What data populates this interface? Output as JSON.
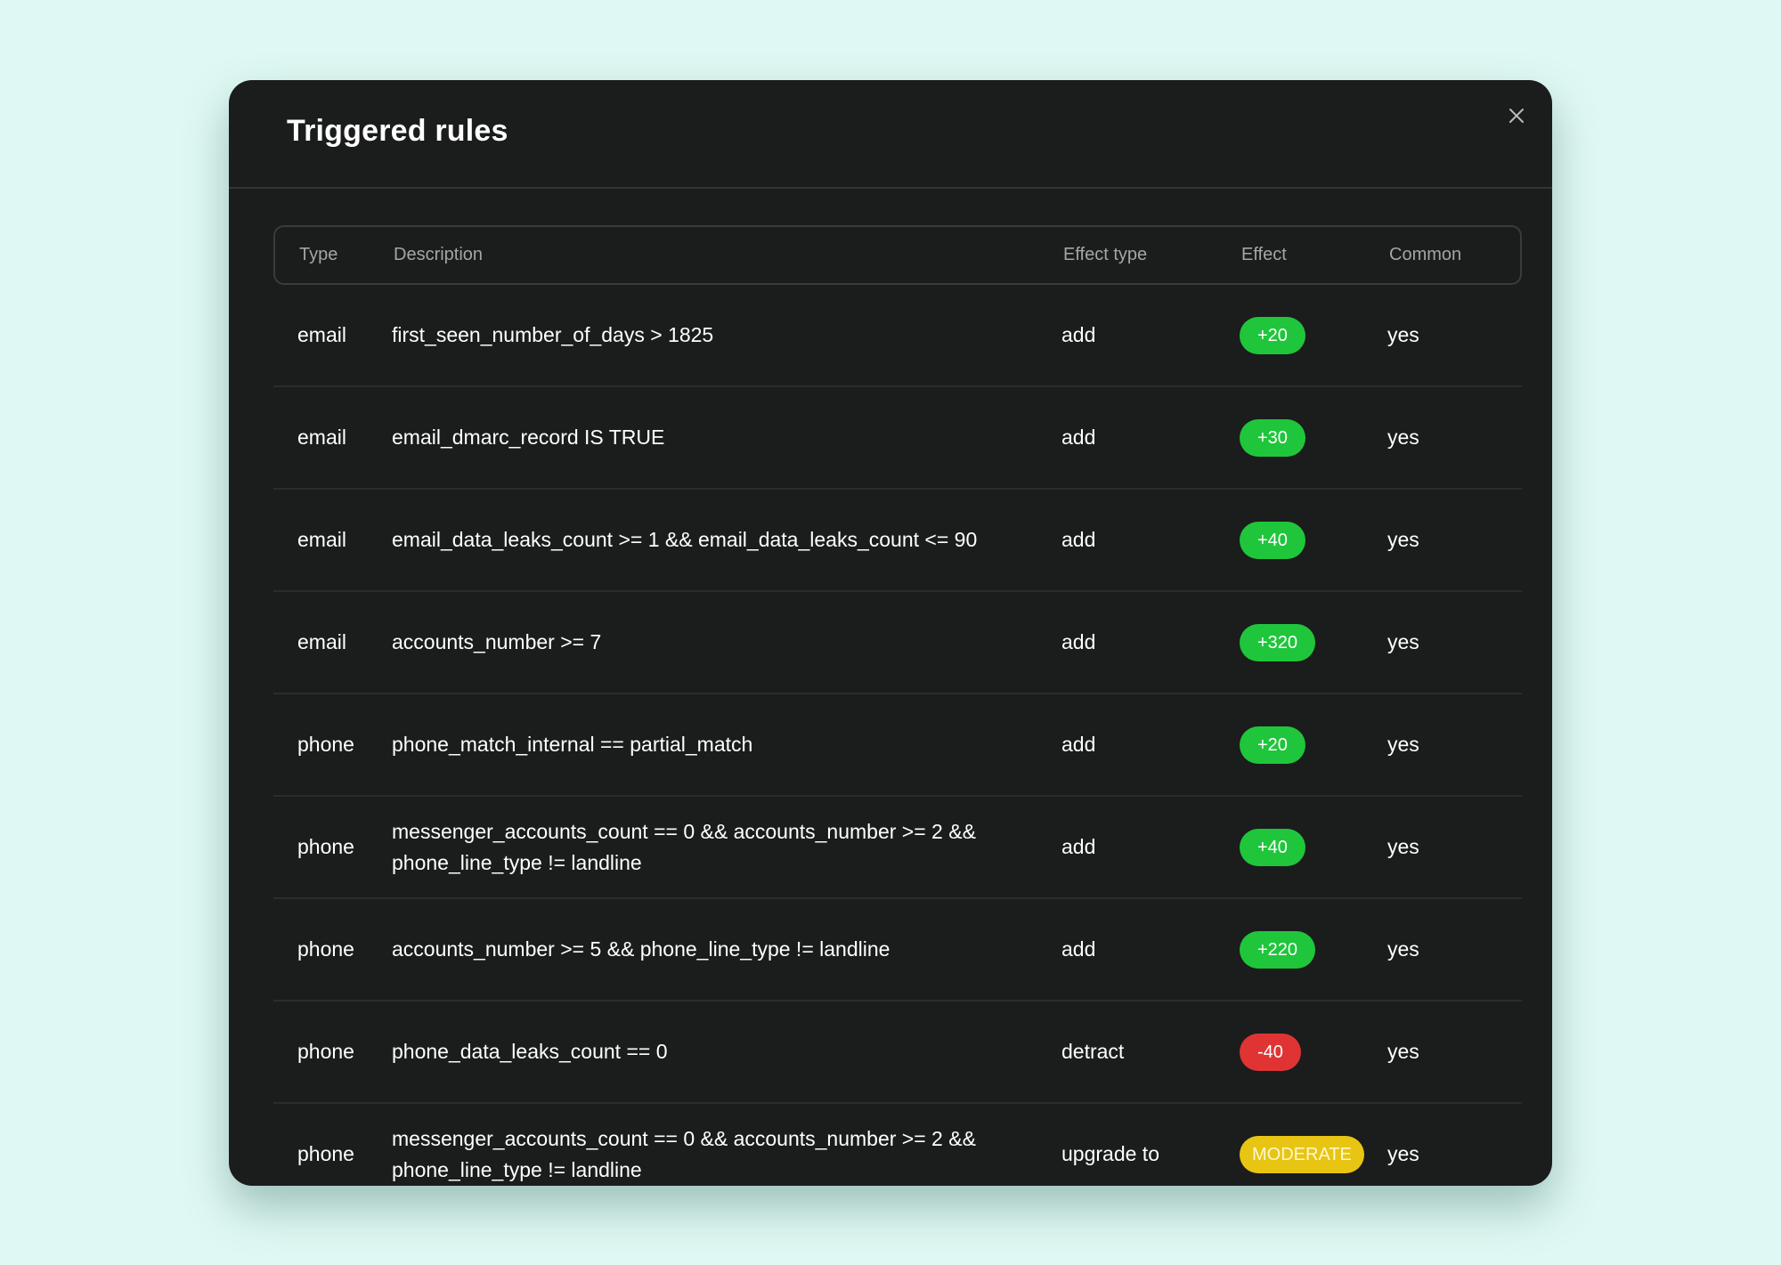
{
  "modal": {
    "title": "Triggered rules",
    "close_icon": "close-icon"
  },
  "table": {
    "headers": {
      "type": "Type",
      "description": "Description",
      "effect_type": "Effect type",
      "effect": "Effect",
      "common": "Common"
    },
    "rows": [
      {
        "type": "email",
        "description": "first_seen_number_of_days > 1825",
        "effect_type": "add",
        "effect": "+20",
        "effect_color": "green",
        "common": "yes"
      },
      {
        "type": "email",
        "description": "email_dmarc_record IS TRUE",
        "effect_type": "add",
        "effect": "+30",
        "effect_color": "green",
        "common": "yes"
      },
      {
        "type": "email",
        "description": "email_data_leaks_count >= 1 && email_data_leaks_count <= 90",
        "effect_type": "add",
        "effect": "+40",
        "effect_color": "green",
        "common": "yes"
      },
      {
        "type": "email",
        "description": "accounts_number >= 7",
        "effect_type": "add",
        "effect": "+320",
        "effect_color": "green",
        "common": "yes"
      },
      {
        "type": "phone",
        "description": "phone_match_internal == partial_match",
        "effect_type": "add",
        "effect": "+20",
        "effect_color": "green",
        "common": "yes"
      },
      {
        "type": "phone",
        "description": "messenger_accounts_count == 0 && accounts_number >= 2 && phone_line_type != landline",
        "effect_type": "add",
        "effect": "+40",
        "effect_color": "green",
        "common": "yes"
      },
      {
        "type": "phone",
        "description": "accounts_number >= 5 && phone_line_type != landline",
        "effect_type": "add",
        "effect": "+220",
        "effect_color": "green",
        "common": "yes"
      },
      {
        "type": "phone",
        "description": "phone_data_leaks_count == 0",
        "effect_type": "detract",
        "effect": "-40",
        "effect_color": "red",
        "common": "yes"
      },
      {
        "type": "phone",
        "description": "messenger_accounts_count == 0 && accounts_number >= 2 && phone_line_type != landline",
        "effect_type": "upgrade to",
        "effect": "MODERATE",
        "effect_color": "yellow",
        "common": "yes"
      }
    ]
  },
  "colors": {
    "green": "#1fc63b",
    "red": "#e03434",
    "yellow": "#e8c513",
    "background": "#dff8f3",
    "modal": "#1b1c1c"
  }
}
